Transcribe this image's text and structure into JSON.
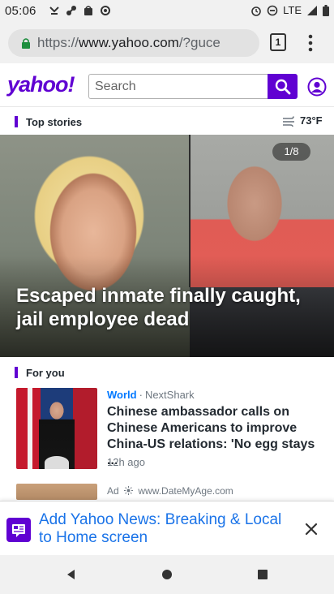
{
  "status_bar": {
    "time": "05:06",
    "network": "LTE"
  },
  "browser": {
    "url_scheme": "https://",
    "url_host": "www.yahoo.com",
    "url_path": "/?guce",
    "tab_count": "1"
  },
  "yahoo_header": {
    "logo": "yahoo!",
    "search_placeholder": "Search",
    "accent_color": "#6001d2"
  },
  "top_stories": {
    "label": "Top stories",
    "weather": "73°F",
    "hero": {
      "counter": "1/8",
      "title": "Escaped inmate finally caught, jail employee dead"
    }
  },
  "for_you": {
    "label": "For you",
    "stories": [
      {
        "category": "World",
        "source": "NextShark",
        "title": "Chinese ambassador calls on Chinese Americans to improve China-US relations: 'No egg stays ...",
        "time": "12h ago"
      }
    ],
    "ad": {
      "label": "Ad",
      "source": "www.DateMyAge.com"
    }
  },
  "add_to_home_banner": {
    "text": "Add Yahoo News: Breaking & Local to Home screen"
  }
}
